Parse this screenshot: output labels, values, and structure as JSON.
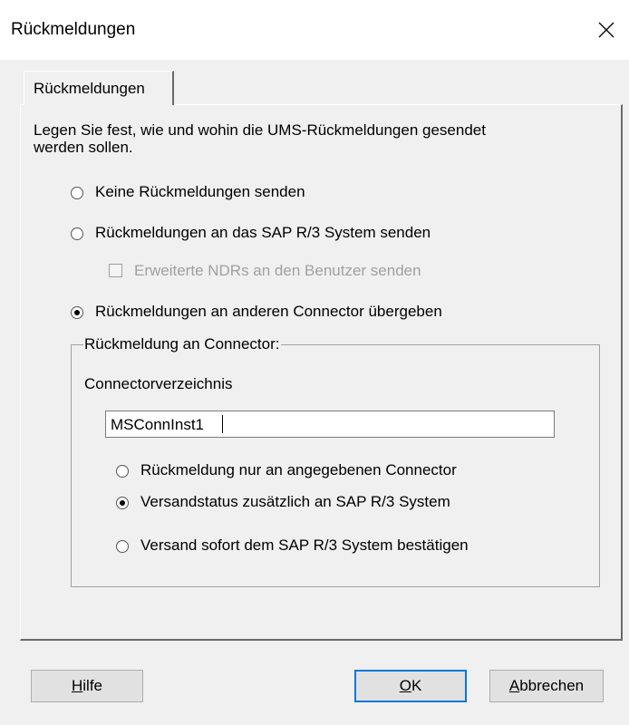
{
  "window": {
    "title": "Rückmeldungen"
  },
  "tabs": [
    {
      "label": "Rückmeldungen"
    }
  ],
  "description": {
    "line1": "Legen Sie fest, wie und wohin die UMS-Rückmeldungen gesendet",
    "line2": "werden sollen."
  },
  "options": [
    {
      "label": "Keine Rückmeldungen senden",
      "selected": false
    },
    {
      "label": "Rückmeldungen an das SAP R/3 System senden",
      "selected": false
    },
    {
      "label": "Rückmeldungen an anderen Connector übergeben",
      "selected": true
    }
  ],
  "ndr_checkbox": {
    "label": "Erweiterte NDRs an den Benutzer senden",
    "checked": false,
    "enabled": false
  },
  "connector_group": {
    "legend": "Rückmeldung an Connector:",
    "dir_label": "Connectorverzeichnis",
    "dir_value": "MSConnInst1",
    "suboptions": [
      {
        "label": "Rückmeldung nur an angegebenen Connector",
        "selected": false
      },
      {
        "label": "Versandstatus zusätzlich an SAP R/3 System",
        "selected": true
      },
      {
        "label": "Versand sofort dem SAP R/3 System bestätigen",
        "selected": false
      }
    ]
  },
  "buttons": {
    "help": {
      "mnemonic": "H",
      "rest": "ilfe"
    },
    "ok": {
      "mnemonic": "O",
      "rest": "K"
    },
    "cancel": {
      "mnemonic": "A",
      "rest": "bbrechen"
    }
  },
  "icons": {
    "close": "close-icon"
  }
}
